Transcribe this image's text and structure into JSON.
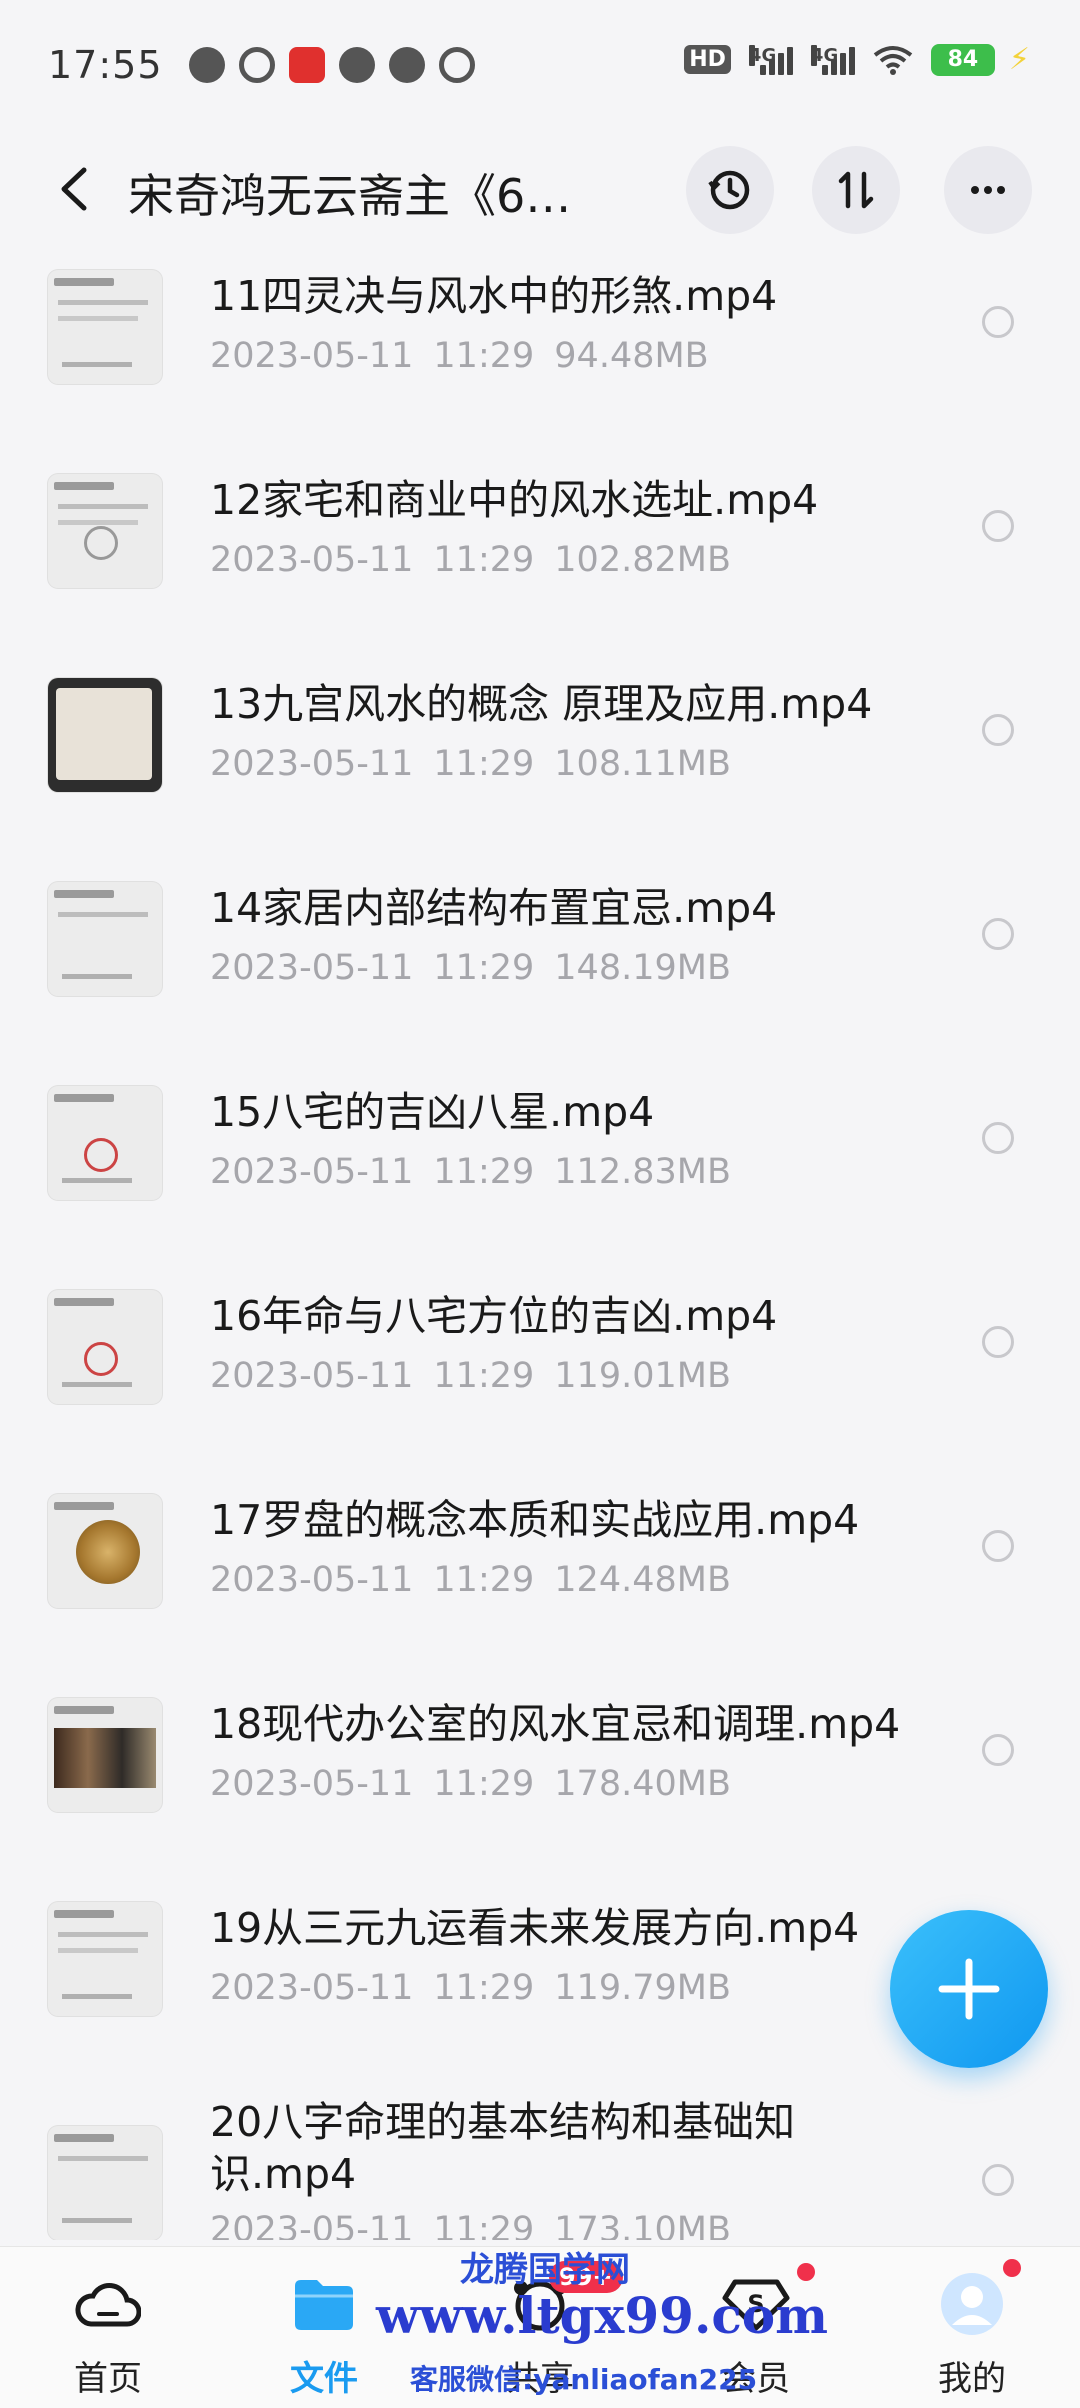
{
  "status_bar": {
    "time": "17:55",
    "hd_label": "HD",
    "net1": "4G",
    "net2": "4G",
    "battery": "84"
  },
  "header": {
    "title": "宋奇鸿无云斋主《6…"
  },
  "files": [
    {
      "name": "11四灵决与风水中的形煞.mp4",
      "date": "2023-05-11",
      "time": "11:29",
      "size": "94.48MB"
    },
    {
      "name": "12家宅和商业中的风水选址.mp4",
      "date": "2023-05-11",
      "time": "11:29",
      "size": "102.82MB"
    },
    {
      "name": "13九宫风水的概念 原理及应用.mp4",
      "date": "2023-05-11",
      "time": "11:29",
      "size": "108.11MB"
    },
    {
      "name": "14家居内部结构布置宜忌.mp4",
      "date": "2023-05-11",
      "time": "11:29",
      "size": "148.19MB"
    },
    {
      "name": "15八宅的吉凶八星.mp4",
      "date": "2023-05-11",
      "time": "11:29",
      "size": "112.83MB"
    },
    {
      "name": "16年命与八宅方位的吉凶.mp4",
      "date": "2023-05-11",
      "time": "11:29",
      "size": "119.01MB"
    },
    {
      "name": "17罗盘的概念本质和实战应用.mp4",
      "date": "2023-05-11",
      "time": "11:29",
      "size": "124.48MB"
    },
    {
      "name": "18现代办公室的风水宜忌和调理.mp4",
      "date": "2023-05-11",
      "time": "11:29",
      "size": "178.40MB"
    },
    {
      "name": "19从三元九运看未来发展方向.mp4",
      "date": "2023-05-11",
      "time": "11:29",
      "size": "119.79MB"
    },
    {
      "name_line1": "20八字命理的基本结构和基础知",
      "name_line2": "识.mp4",
      "date": "2023-05-11",
      "time": "11:29",
      "size": "173.10MB"
    }
  ],
  "bottom_nav": {
    "home": "首页",
    "files": "文件",
    "share": "共享",
    "share_badge": "99+",
    "vip": "会员",
    "mine": "我的"
  },
  "watermark": {
    "line1": "龙腾国学网",
    "line2": "www.ltgx99.com",
    "line3": "客服微信:yanliaofan225"
  },
  "colors": {
    "accent": "#1a9bf0",
    "meta_text": "#a6a6ab",
    "badge": "#f0304b"
  }
}
